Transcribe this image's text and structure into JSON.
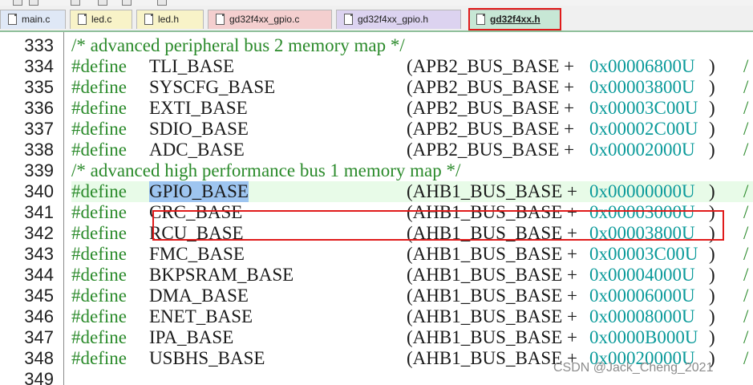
{
  "tabs": [
    {
      "label": "main.c"
    },
    {
      "label": "led.c"
    },
    {
      "label": "led.h"
    },
    {
      "label": "gd32f4xx_gpio.c"
    },
    {
      "label": "gd32f4xx_gpio.h"
    },
    {
      "label": "gd32f4xx.h"
    }
  ],
  "active_tab": "gd32f4xx.h",
  "colors": {
    "keyword": "#2a8a2a",
    "comment": "#2a8a2a",
    "number": "#0a9a9a",
    "annotation": "#e01b1b",
    "selection": "#9ec5f0"
  },
  "lines": [
    {
      "num": "333",
      "comment": "/* advanced peripheral bus 2 memory map */"
    },
    {
      "num": "334",
      "kw": "#define",
      "name": "TLI_BASE",
      "bus": "(APB2_BUS_BASE +",
      "offset": "0x00006800U",
      "close": ")",
      "tail": "/"
    },
    {
      "num": "335",
      "kw": "#define",
      "name": "SYSCFG_BASE",
      "bus": "(APB2_BUS_BASE +",
      "offset": "0x00003800U",
      "close": ")",
      "tail": "/"
    },
    {
      "num": "336",
      "kw": "#define",
      "name": "EXTI_BASE",
      "bus": "(APB2_BUS_BASE +",
      "offset": "0x00003C00U",
      "close": ")",
      "tail": "/"
    },
    {
      "num": "337",
      "kw": "#define",
      "name": "SDIO_BASE",
      "bus": "(APB2_BUS_BASE +",
      "offset": "0x00002C00U",
      "close": ")",
      "tail": "/"
    },
    {
      "num": "338",
      "kw": "#define",
      "name": "ADC_BASE",
      "bus": "(APB2_BUS_BASE +",
      "offset": "0x00002000U",
      "close": ")",
      "tail": "/"
    },
    {
      "num": "339",
      "comment": "/* advanced high performance bus 1 memory map */"
    },
    {
      "num": "340",
      "kw": "#define",
      "name": "GPIO_BASE",
      "bus": "(AHB1_BUS_BASE +",
      "offset": "0x00000000U",
      "close": ")",
      "tail": "/"
    },
    {
      "num": "341",
      "kw": "#define",
      "name": "CRC_BASE",
      "bus": "(AHB1_BUS_BASE +",
      "offset": "0x00003000U",
      "close": ")",
      "tail": "/"
    },
    {
      "num": "342",
      "kw": "#define",
      "name": "RCU_BASE",
      "bus": "(AHB1_BUS_BASE +",
      "offset": "0x00003800U",
      "close": ")",
      "tail": "/"
    },
    {
      "num": "343",
      "kw": "#define",
      "name": "FMC_BASE",
      "bus": "(AHB1_BUS_BASE +",
      "offset": "0x00003C00U",
      "close": ")",
      "tail": "/"
    },
    {
      "num": "344",
      "kw": "#define",
      "name": "BKPSRAM_BASE",
      "bus": "(AHB1_BUS_BASE +",
      "offset": "0x00004000U",
      "close": ")",
      "tail": "/"
    },
    {
      "num": "345",
      "kw": "#define",
      "name": "DMA_BASE",
      "bus": "(AHB1_BUS_BASE +",
      "offset": "0x00006000U",
      "close": ")",
      "tail": "/"
    },
    {
      "num": "346",
      "kw": "#define",
      "name": "ENET_BASE",
      "bus": "(AHB1_BUS_BASE +",
      "offset": "0x00008000U",
      "close": ")",
      "tail": "/"
    },
    {
      "num": "347",
      "kw": "#define",
      "name": "IPA_BASE",
      "bus": "(AHB1_BUS_BASE +",
      "offset": "0x0000B000U",
      "close": ")",
      "tail": "/"
    },
    {
      "num": "348",
      "kw": "#define",
      "name": "USBHS_BASE",
      "bus": "(AHB1_BUS_BASE +",
      "offset": "0x00020000U",
      "close": ")",
      "tail": "/"
    },
    {
      "num": "349"
    }
  ],
  "watermark": "CSDN @Jack_Cheng_2021"
}
